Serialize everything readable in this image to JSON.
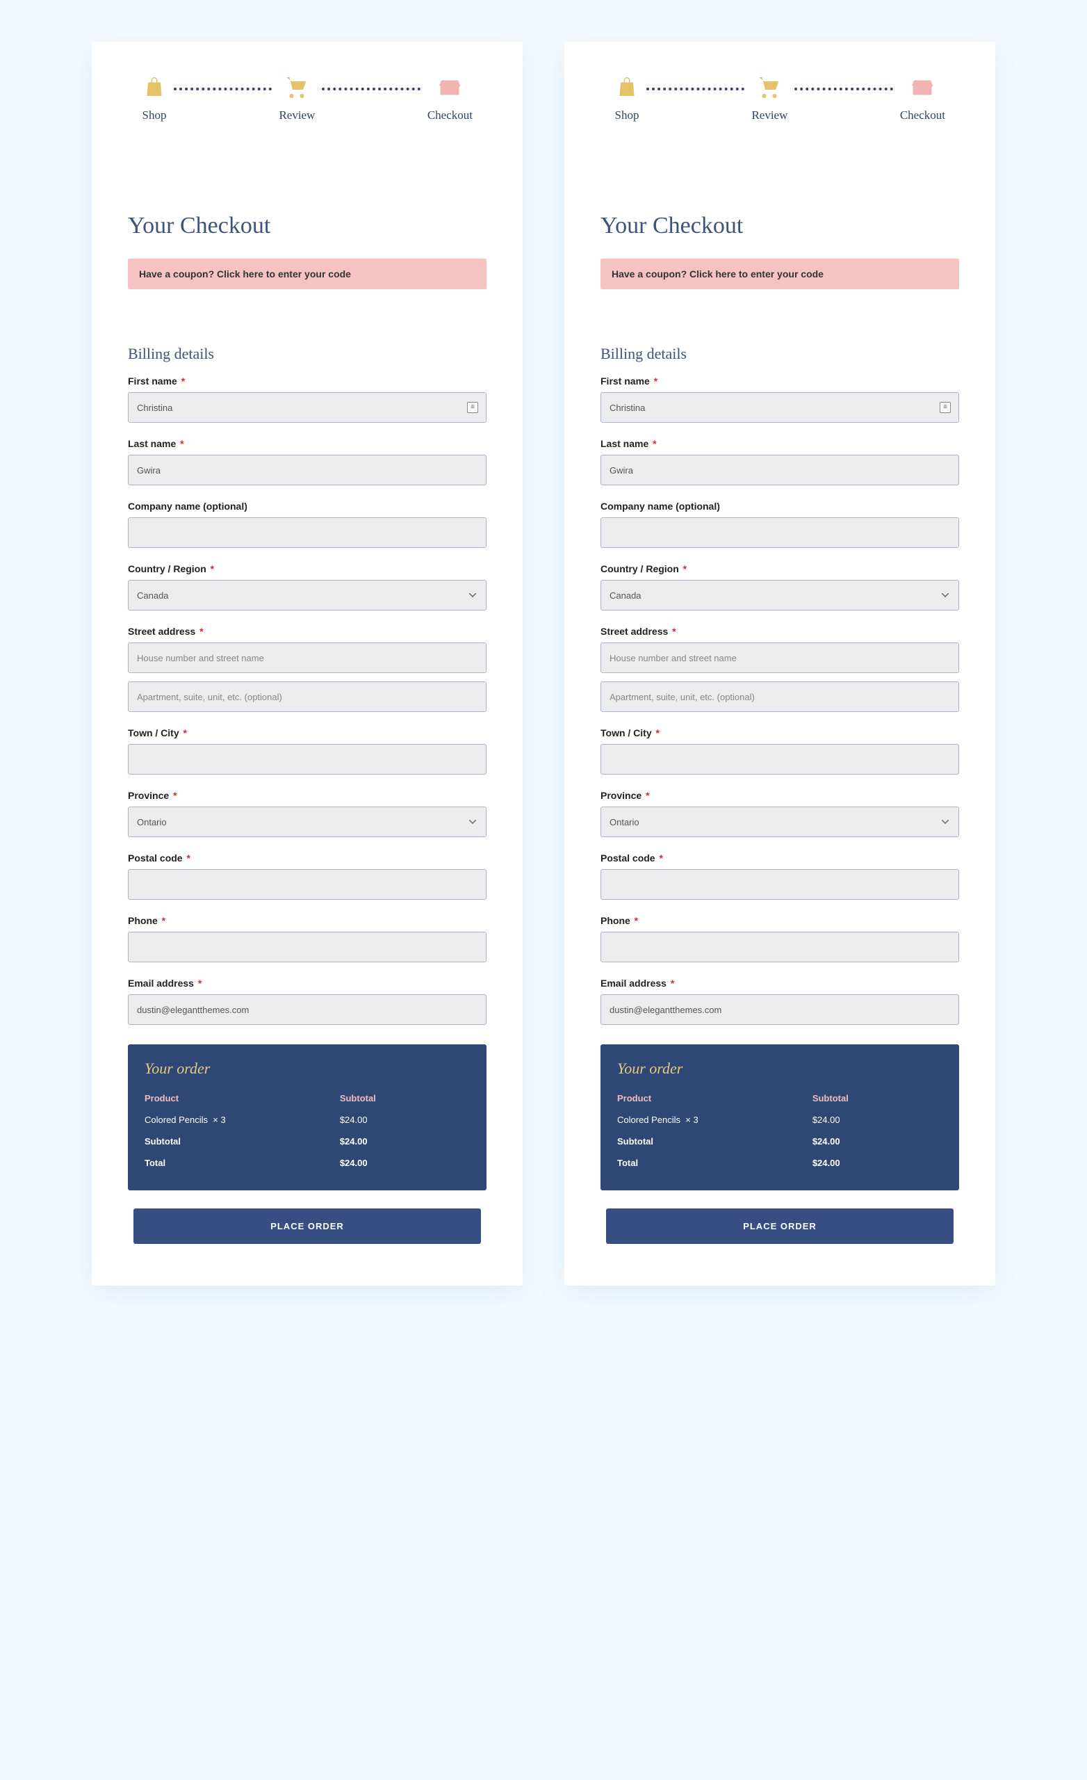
{
  "progress": {
    "steps": [
      {
        "label": "Shop"
      },
      {
        "label": "Review"
      },
      {
        "label": "Checkout"
      }
    ]
  },
  "page_title": "Your Checkout",
  "coupon_text": "Have a coupon? Click here to enter your code",
  "billing": {
    "section_title": "Billing details",
    "fields": {
      "first_name": {
        "label": "First name",
        "value": "Christina"
      },
      "last_name": {
        "label": "Last name",
        "value": "Gwira"
      },
      "company": {
        "label": "Company name (optional)",
        "value": ""
      },
      "country": {
        "label": "Country / Region",
        "value": "Canada"
      },
      "street": {
        "label": "Street address",
        "placeholder1": "House number and street name",
        "placeholder2": "Apartment, suite, unit, etc. (optional)"
      },
      "city": {
        "label": "Town / City",
        "value": ""
      },
      "province": {
        "label": "Province",
        "value": "Ontario"
      },
      "postal": {
        "label": "Postal code",
        "value": ""
      },
      "phone": {
        "label": "Phone",
        "value": ""
      },
      "email": {
        "label": "Email address",
        "value": "dustin@elegantthemes.com"
      }
    }
  },
  "order": {
    "title": "Your order",
    "headers": {
      "product": "Product",
      "subtotal": "Subtotal"
    },
    "item": {
      "name": "Colored Pencils",
      "qty": "× 3",
      "price": "$24.00"
    },
    "subtotal": {
      "label": "Subtotal",
      "value": "$24.00"
    },
    "total": {
      "label": "Total",
      "value": "$24.00"
    }
  },
  "place_order_label": "PLACE ORDER",
  "required_mark": "*"
}
